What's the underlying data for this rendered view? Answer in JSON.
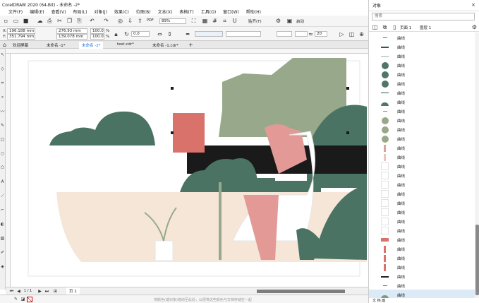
{
  "title": "CorelDRAW 2020 (64-Bit) - 未命名 -2*",
  "menu": [
    "文件(F)",
    "编辑(E)",
    "查看(V)",
    "布局(L)",
    "对象(J)",
    "效果(C)",
    "位图(B)",
    "文本(X)",
    "表格(T)",
    "工具(O)",
    "窗口(W)",
    "帮助(H)"
  ],
  "toolbar1": {
    "zoom": "89%",
    "snap_label": "贴齐(T)",
    "launch_label": "启动",
    "pdf_label": "PDF"
  },
  "property_bar": {
    "x_label": "X:",
    "x": "196.188 mm",
    "y_label": "Y:",
    "y": "351.794 mm",
    "w": "276.93 mm",
    "h": "139.078 mm",
    "scale_w": "100.0",
    "scale_h": "100.0",
    "pct": "%",
    "angle": "0.0",
    "outline_value": "20"
  },
  "tabs": [
    "欢迎屏幕",
    "未命名 -1*",
    "未命名 -2*",
    "test.cdr*",
    "未命名 -1.cdr*"
  ],
  "active_tab": 2,
  "pagenav": {
    "page_label": "页 1",
    "page_count": "1 / 1"
  },
  "status_hint": "将颜色(或对象)拖动至此处，以便将这些颜色与文档存储在一起",
  "panel": {
    "title": "对象",
    "search_placeholder": "搜索",
    "page_label": "页面 1",
    "layer_label": "图层 1",
    "footer_label": "文 档 面",
    "rows": [
      {
        "label": "曲线",
        "thumb": "line-short",
        "color": "#5d7a66"
      },
      {
        "label": "曲线",
        "thumb": "line-thick",
        "color": "#2f5b4a"
      },
      {
        "label": "曲线",
        "thumb": "line-faint",
        "color": "#c9d4cb"
      },
      {
        "label": "曲线",
        "thumb": "circle",
        "color": "#4f7767"
      },
      {
        "label": "曲线",
        "thumb": "circle",
        "color": "#4f7767"
      },
      {
        "label": "曲线",
        "thumb": "circle",
        "color": "#4f7767"
      },
      {
        "label": "曲线",
        "thumb": "line-thin",
        "color": "#2f5b4a"
      },
      {
        "label": "曲线",
        "thumb": "hill",
        "color": "#4f7767"
      },
      {
        "label": "曲线",
        "thumb": "line-short",
        "color": "#7b8e80"
      },
      {
        "label": "曲线",
        "thumb": "circle",
        "color": "#9aa88a"
      },
      {
        "label": "曲线",
        "thumb": "circle",
        "color": "#9aa88a"
      },
      {
        "label": "曲线",
        "thumb": "circle",
        "color": "#9aa88a"
      },
      {
        "label": "曲线",
        "thumb": "vbar-pink",
        "color": "#d9a39b"
      },
      {
        "label": "曲线",
        "thumb": "vbar-pale",
        "color": "#e4c7c0"
      },
      {
        "label": "曲线",
        "thumb": "blank",
        "color": "#eeeeee"
      },
      {
        "label": "曲线",
        "thumb": "blank",
        "color": "#eeeeee"
      },
      {
        "label": "曲线",
        "thumb": "blank",
        "color": "#eeeeee"
      },
      {
        "label": "曲线",
        "thumb": "blank",
        "color": "#eeeeee"
      },
      {
        "label": "曲线",
        "thumb": "blank",
        "color": "#eeeeee"
      },
      {
        "label": "曲线",
        "thumb": "blank",
        "color": "#eeeeee"
      },
      {
        "label": "曲线",
        "thumb": "blank",
        "color": "#eeeeee"
      },
      {
        "label": "曲线",
        "thumb": "blank",
        "color": "#eeeeee"
      },
      {
        "label": "曲线",
        "thumb": "block",
        "color": "#d9726b"
      },
      {
        "label": "曲线",
        "thumb": "vbar-red",
        "color": "#d9726b"
      },
      {
        "label": "曲线",
        "thumb": "vbar-red",
        "color": "#d9726b"
      },
      {
        "label": "曲线",
        "thumb": "vbar-red",
        "color": "#d9726b"
      },
      {
        "label": "曲线",
        "thumb": "line-thick",
        "color": "#222222"
      },
      {
        "label": "曲线",
        "thumb": "line-short",
        "color": "#5d7a66"
      },
      {
        "label": "曲线",
        "thumb": "hill",
        "color": "#7b9a7e"
      }
    ],
    "selected_row": 28
  },
  "colors": {
    "sage": "#97a98a",
    "dark_green": "#4a7363",
    "peach": "#f6e6d8",
    "coral": "#d9726b",
    "pink": "#e39a97",
    "black": "#1a1a1a",
    "accent": "#1a73e8"
  }
}
